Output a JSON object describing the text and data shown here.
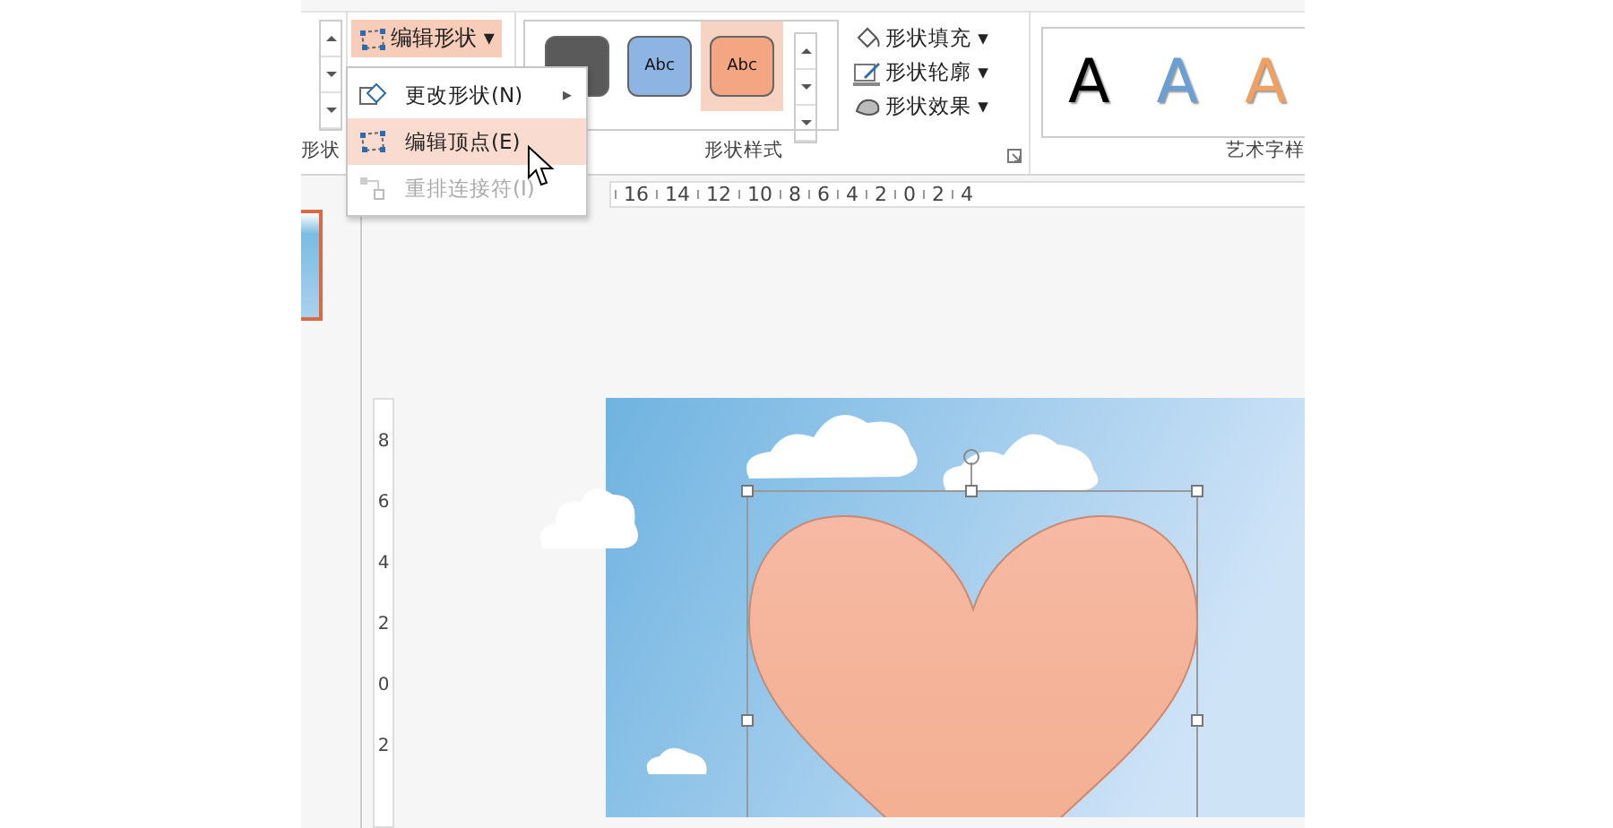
{
  "ribbon": {
    "left_group": {
      "label": "形状"
    },
    "edit_shape_button": {
      "label": "编辑形状",
      "caret": "▾",
      "selected": true
    },
    "edit_shape_menu": [
      {
        "label": "更改形状(N)",
        "submenu": "▸",
        "selected": false,
        "disabled": false
      },
      {
        "label": "编辑顶点(E)",
        "selected": true,
        "disabled": false
      },
      {
        "label": "重排连接符(I)",
        "selected": false,
        "disabled": true
      }
    ],
    "shape_styles": {
      "label": "形状样式",
      "swatches": [
        {
          "color": "#5a5a5a",
          "selected": false
        },
        {
          "text": "Abc",
          "color": "#8eb4e3",
          "selected": false
        },
        {
          "text": "Abc",
          "color": "#f4a582",
          "selected": true
        }
      ],
      "commands": [
        {
          "kind": "fill",
          "label": "形状填充",
          "caret": "▾"
        },
        {
          "kind": "outline",
          "label": "形状轮廓",
          "caret": "▾"
        },
        {
          "kind": "effects",
          "label": "形状效果",
          "caret": "▾"
        }
      ]
    },
    "wordart_styles": {
      "label": "艺术字样",
      "letters": [
        {
          "text": "A",
          "color": "#000000"
        },
        {
          "text": "A",
          "color": "#6a9fd6"
        },
        {
          "text": "A",
          "color": "#f0a060"
        }
      ]
    }
  },
  "horizontal_ruler": [
    "16",
    "14",
    "12",
    "10",
    "8",
    "6",
    "4",
    "2",
    "0",
    "2",
    "4"
  ],
  "vertical_ruler": [
    "8",
    "6",
    "4",
    "2",
    "0",
    "2"
  ]
}
